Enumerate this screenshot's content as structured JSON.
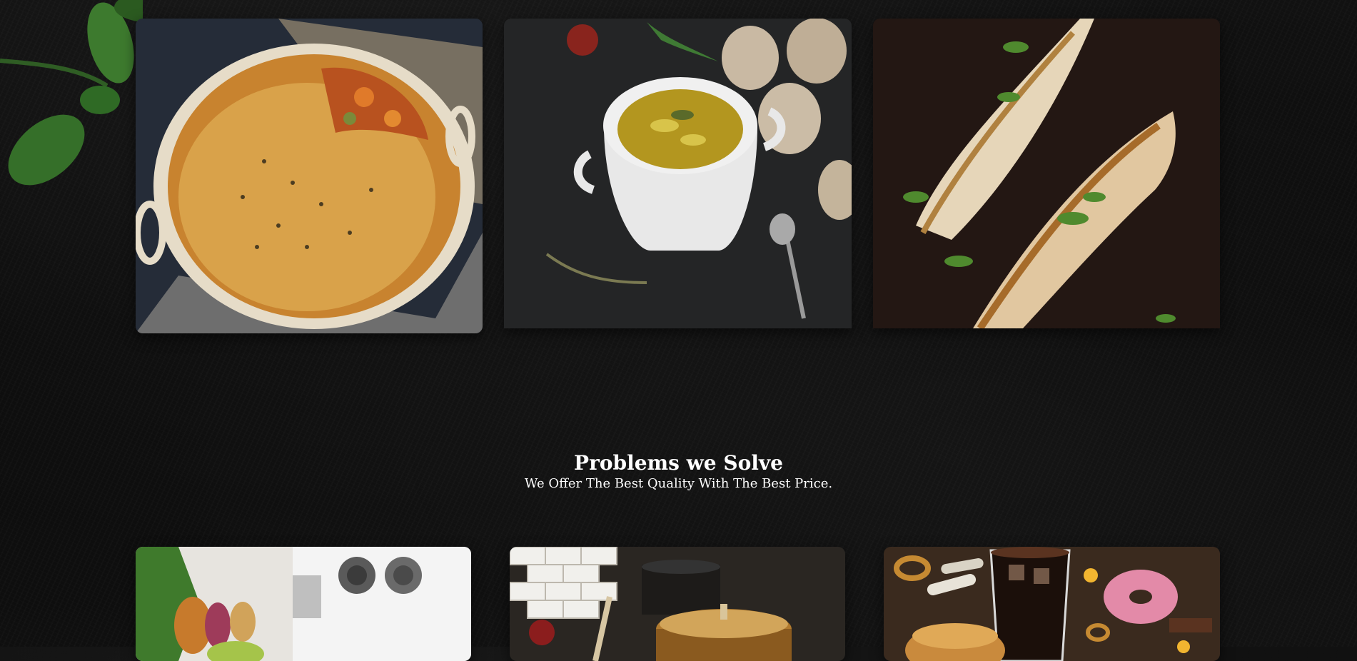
{
  "problems_section": {
    "title": "Problems we Solve",
    "subtitle": "We Offer The Best Quality With The Best Price."
  },
  "gallery": {
    "images": [
      {
        "name": "pot-pie-photo"
      },
      {
        "name": "clam-soup-photo"
      },
      {
        "name": "grilled-fish-photo"
      }
    ]
  },
  "problem_cards": {
    "images": [
      {
        "name": "fresh-produce-kitchen-photo"
      },
      {
        "name": "copper-pot-kitchen-photo"
      },
      {
        "name": "junk-food-cola-photo"
      }
    ]
  },
  "colors": {
    "background": "#0c0c0c",
    "heading_text": "#ffffff"
  }
}
